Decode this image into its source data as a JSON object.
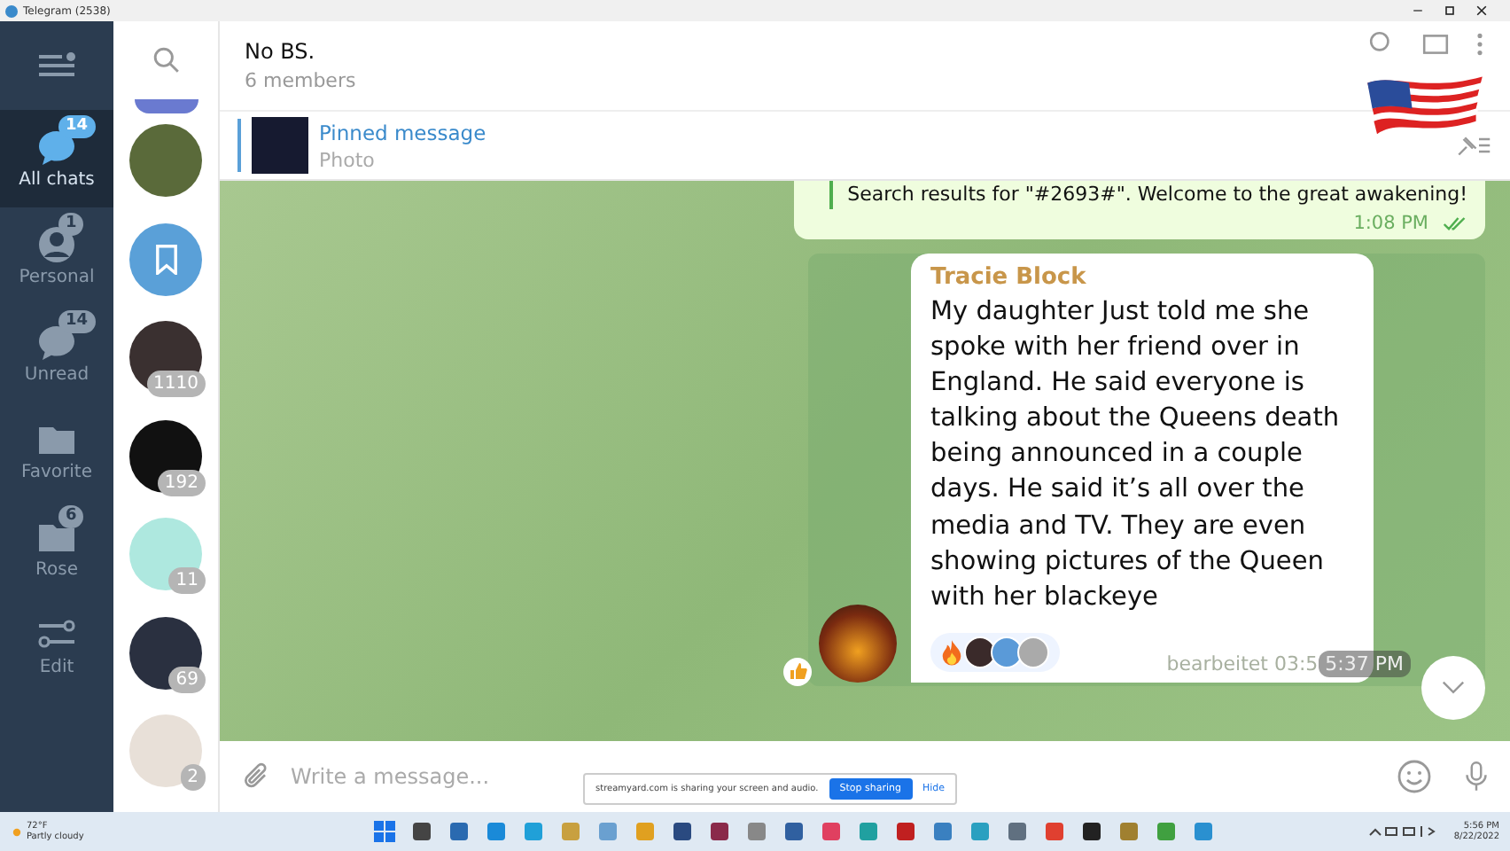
{
  "window": {
    "title": "Telegram (2538)"
  },
  "folders": [
    {
      "label": "All chats",
      "badge": "14",
      "selected": true,
      "kind": "chats"
    },
    {
      "label": "Personal",
      "badge": "1",
      "selected": false,
      "kind": "person"
    },
    {
      "label": "Unread",
      "badge": "14",
      "selected": false,
      "kind": "chat"
    },
    {
      "label": "Favorite",
      "selected": false,
      "kind": "folder"
    },
    {
      "label": "Rose",
      "badge": "6",
      "selected": false,
      "kind": "folder"
    },
    {
      "label": "Edit",
      "selected": false,
      "kind": "edit"
    }
  ],
  "chat_list": [
    {
      "kind": "photo",
      "color": "#5a6a3a"
    },
    {
      "kind": "saved",
      "color": "#5aa0d8"
    },
    {
      "kind": "photo",
      "badge": "1110",
      "color": "#3a3030"
    },
    {
      "kind": "photo",
      "badge": "192",
      "color": "#111111"
    },
    {
      "kind": "photo",
      "badge": "11",
      "color": "#aee8df"
    },
    {
      "kind": "photo",
      "badge": "69",
      "color": "#2a3040"
    },
    {
      "kind": "photo",
      "badge": "2",
      "color": "#e8e0d8"
    }
  ],
  "chat": {
    "title": "No BS.",
    "subtitle": "6 members"
  },
  "pinned": {
    "title": "Pinned message",
    "subtitle": "Photo"
  },
  "messages": [
    {
      "kind": "outgoing",
      "text": "Search results for \"#2693#\". Welcome to the great awakening!",
      "time": "1:08 PM",
      "read": true
    },
    {
      "kind": "incoming",
      "sender": "Tracie Block",
      "text": "My daughter Just told me she spoke with her friend over in England. He said everyone is talking about the Queens death being announced in a couple days. He said it’s all over the media and TV.  They are even showing pictures of the Queen with her blackeye",
      "edited": "bearbeitet 03:5",
      "time": "5:37 PM"
    }
  ],
  "composer": {
    "placeholder": "Write a message..."
  },
  "share_bar": {
    "text": "streamyard.com is sharing your screen and audio.",
    "stop": "Stop sharing",
    "hide": "Hide"
  },
  "taskbar": {
    "temperature": "72°F",
    "weather": "Partly cloudy",
    "time": "5:56 PM",
    "date": "8/22/2022"
  }
}
